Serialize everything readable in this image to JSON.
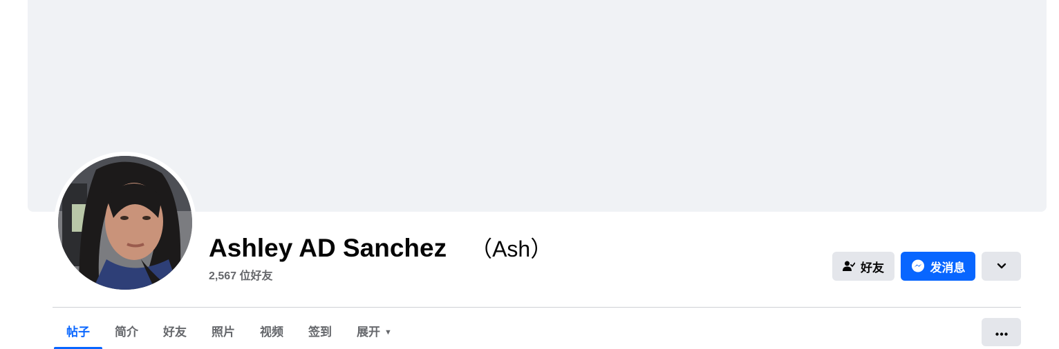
{
  "profile": {
    "name": "Ashley AD Sanchez",
    "nickname": "（Ash）",
    "friends_count": "2,567 位好友"
  },
  "actions": {
    "friends_label": "好友",
    "friends_icon": "person-check-icon",
    "message_label": "发消息",
    "message_icon": "messenger-icon",
    "dropdown_icon": "chevron-down-icon",
    "more_icon": "ellipsis-icon"
  },
  "tabs": [
    {
      "label": "帖子",
      "active": true
    },
    {
      "label": "简介"
    },
    {
      "label": "好友"
    },
    {
      "label": "照片"
    },
    {
      "label": "视频"
    },
    {
      "label": "签到"
    },
    {
      "label": "展开",
      "icon": "caret-down-icon"
    }
  ],
  "colors": {
    "accent": "#0866ff",
    "cover_bg": "#f0f2f5",
    "button_gray": "#e4e6eb",
    "muted_text": "#65676b"
  }
}
